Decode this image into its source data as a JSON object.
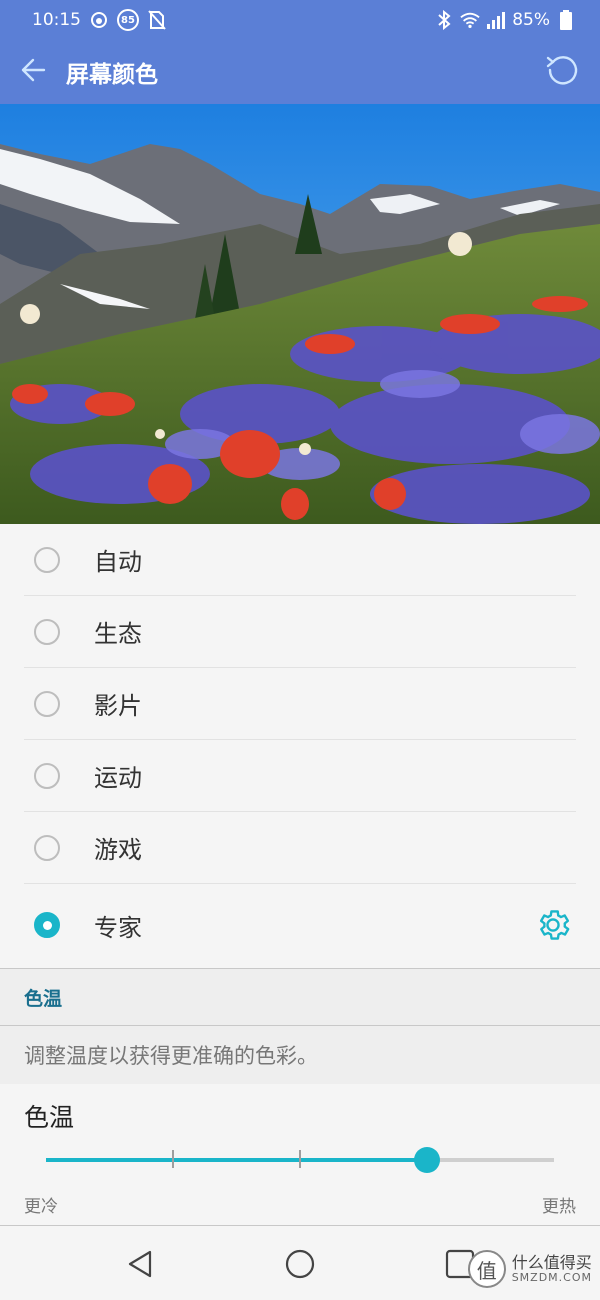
{
  "status_bar": {
    "time": "10:15",
    "badge": "85",
    "battery": "85%",
    "icons": [
      "sync-icon",
      "badge-85-icon",
      "no-sim-icon",
      "bluetooth-icon",
      "wifi-icon",
      "signal-icon",
      "battery-icon"
    ]
  },
  "app_bar": {
    "title": "屏幕颜色",
    "back_icon": "arrow-left-icon",
    "reset_icon": "reset-icon",
    "background": "#5b7fd6"
  },
  "preview": {
    "icon": "mountain-meadow-photo"
  },
  "modes": [
    {
      "label": "自动",
      "selected": false
    },
    {
      "label": "生态",
      "selected": false
    },
    {
      "label": "影片",
      "selected": false
    },
    {
      "label": "运动",
      "selected": false
    },
    {
      "label": "游戏",
      "selected": false
    },
    {
      "label": "专家",
      "selected": true,
      "settings_icon": "gear-icon"
    }
  ],
  "section": {
    "header": "色温",
    "description": "调整温度以获得更准确的色彩。"
  },
  "color_temp": {
    "title": "色温",
    "min_label": "更冷",
    "max_label": "更热",
    "value_fraction": 0.75,
    "accent": "#1ab5c9"
  },
  "nav_bar": {
    "icons": [
      "back-triangle-icon",
      "home-circle-icon",
      "recents-square-icon"
    ]
  },
  "watermark": {
    "logo": "值",
    "text_cn": "什么值得买",
    "text_en": "SMZDM.COM"
  }
}
